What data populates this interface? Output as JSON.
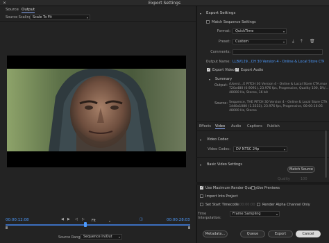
{
  "window": {
    "title": "Export Settings"
  },
  "left": {
    "tabs": [
      "Source",
      "Output"
    ],
    "source_scaling_label": "Source Scaling:",
    "source_scaling_value": "Scale To Fit",
    "timecode_in": "00:00:12:08",
    "timecode_out": "00:00:28:03",
    "fit_value": "Fit",
    "source_range_label": "Source Range:",
    "source_range_value": "Sequence In/Out"
  },
  "right": {
    "export_settings_header": "Export Settings",
    "match_sequence": "Match Sequence Settings",
    "format_label": "Format:",
    "format_value": "QuickTime",
    "preset_label": "Preset:",
    "preset_value": "Custom",
    "comments_label": "Comments:",
    "output_name_label": "Output Name:",
    "output_name_value": "LLBV129...CH 30 Version 4 - Online & Local Store CTA.mov",
    "export_video": "Export Video",
    "export_audio": "Export Audio",
    "summary_header": "Summary",
    "output_label": "Output:",
    "output_lines": [
      "/Users/...E PITCH 30 Version 4 - Online & Local Store CTA.mov",
      "720x480 (0.9091), 23.976 fps, Progressive, Quality 100, DV/...",
      "48000 Hz, Stereo, 16 bit"
    ],
    "source_label": "Source:",
    "source_lines": [
      "Sequence, THE PITCH 30 Version 4 - Online & Local Store CTA",
      "1440x1080 (1.3333), 23.976 fps, Progressive, 00:00:16:05",
      "48000 Hz, Stereo"
    ],
    "tabs": [
      "Effects",
      "Video",
      "Audio",
      "Captions",
      "Publish"
    ],
    "video_codec_header": "Video Codec",
    "video_codec_label": "Video Codec:",
    "video_codec_value": "DV NTSC 24p",
    "basic_video_header": "Basic Video Settings",
    "match_source_btn": "Match Source",
    "quality_label": "Quality",
    "quality_value": "100",
    "use_max_render": "Use Maximum Render Quality",
    "use_previews": "Use Previews",
    "import_into_project": "Import Into Project",
    "set_start_timecode": "Set Start Timecode",
    "start_timecode_value": "00:00:00:00",
    "render_alpha": "Render Alpha Channel Only",
    "time_interp_label": "Time Interpolation:",
    "time_interp_value": "Frame Sampling",
    "metadata_btn": "Metadata...",
    "queue_btn": "Queue",
    "export_btn": "Export",
    "cancel_btn": "Cancel"
  },
  "colors": {
    "accent": "#4d9bff",
    "bg": "#232323"
  }
}
